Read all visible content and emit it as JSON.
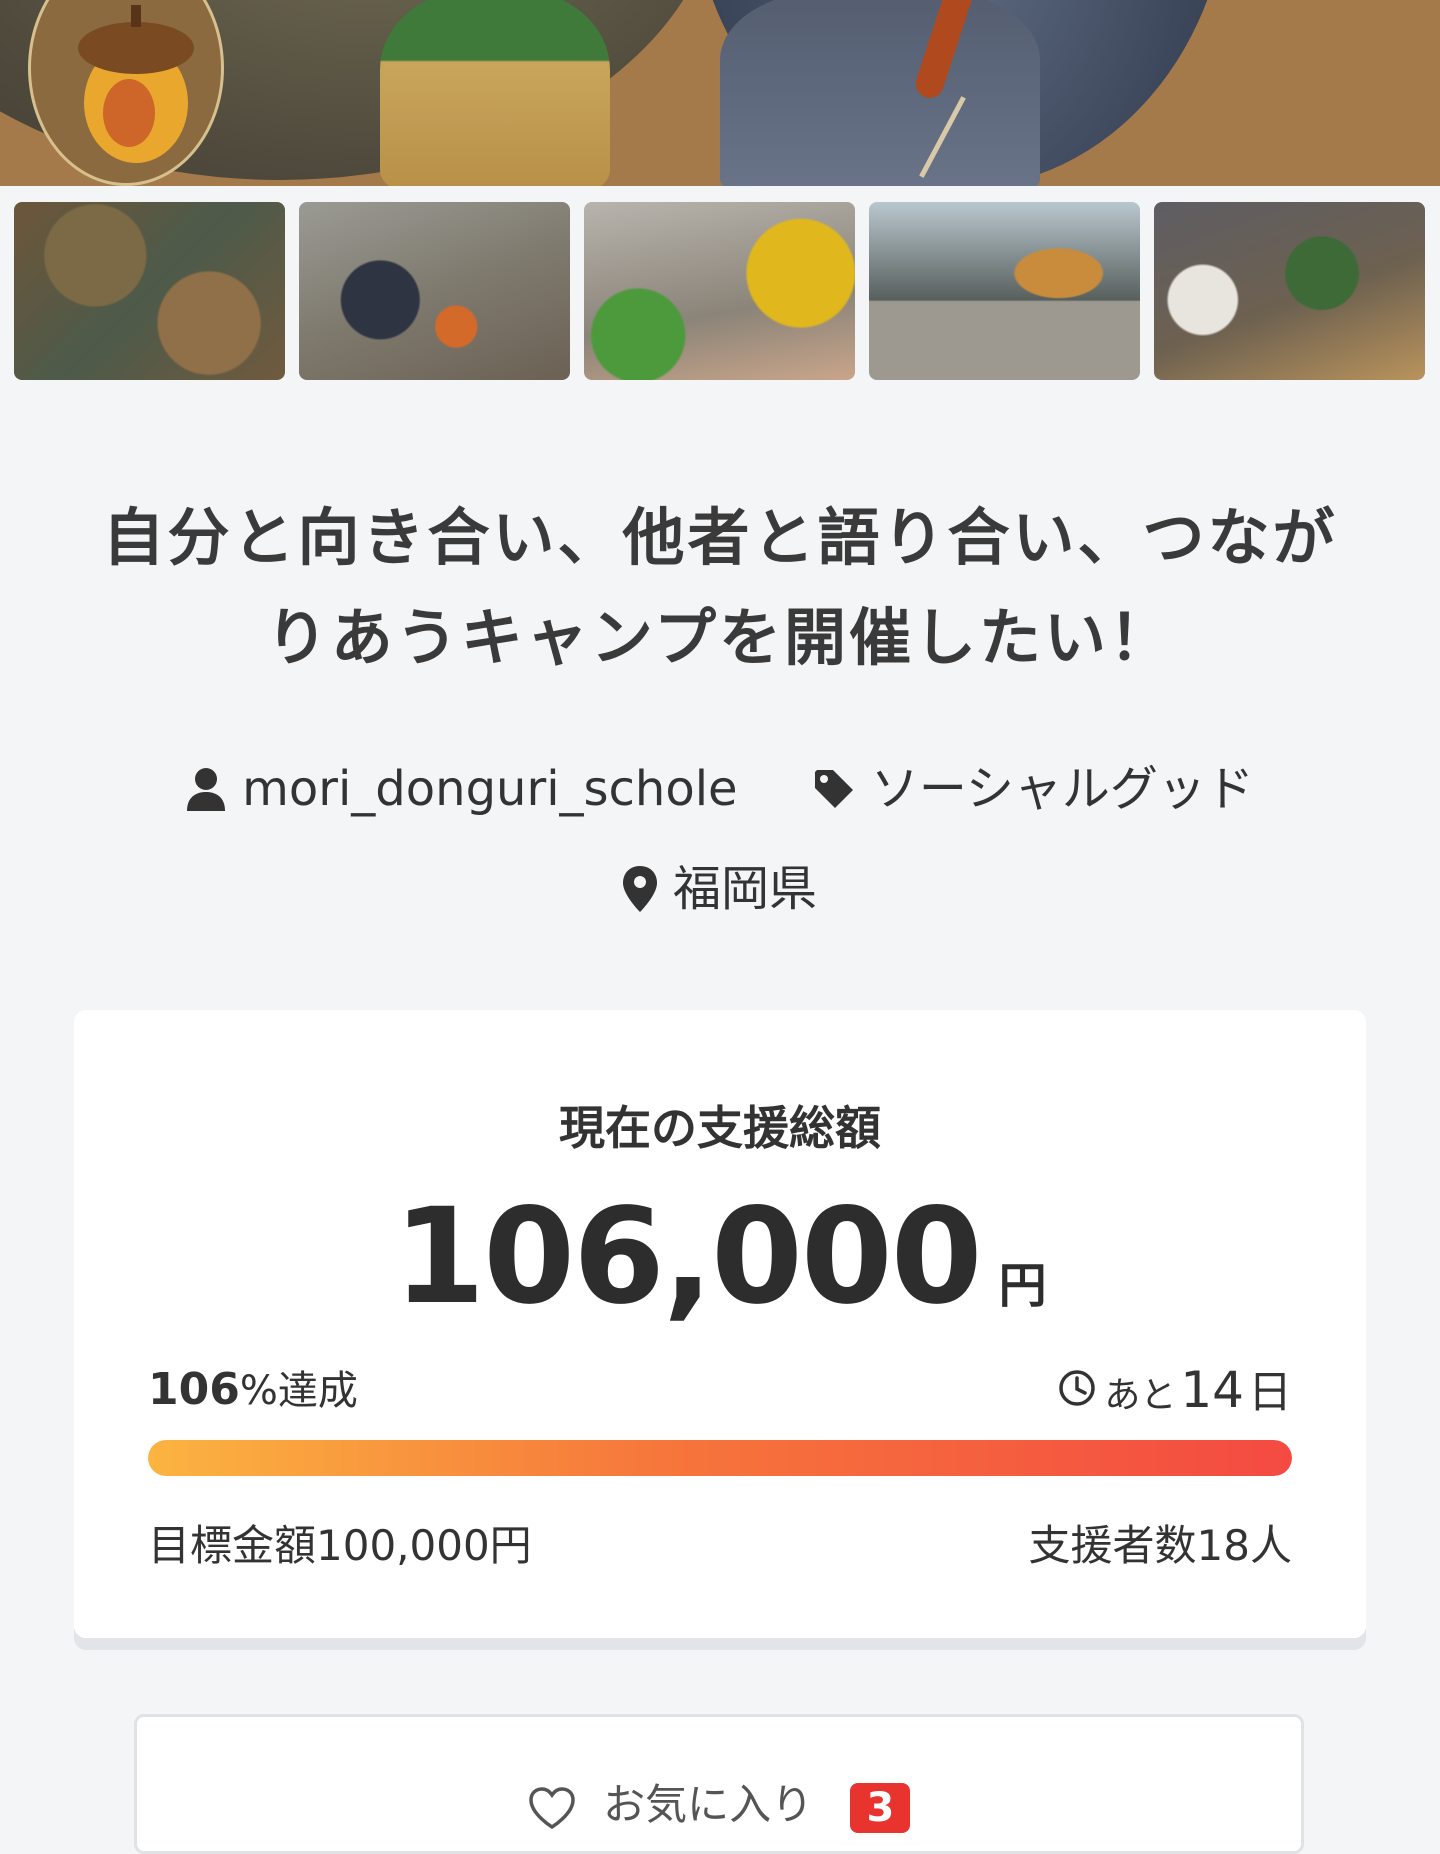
{
  "project": {
    "title": "自分と向き合い、他者と語り合い、つながりあうキャンプを開催したい！",
    "owner": "mori_donguri_schole",
    "category": "ソーシャルグッド",
    "location": "福岡県"
  },
  "icons": {
    "owner": "user-icon",
    "category": "tag-icon",
    "location": "map-pin-icon",
    "remaining": "clock-icon",
    "favorite": "heart-icon"
  },
  "gallery": {
    "thumbnail_count": 5
  },
  "funding": {
    "heading": "現在の支援総額",
    "amount": "106,000",
    "amount_unit": "円",
    "percent": "106",
    "percent_label": "%達成",
    "percent_value": 106,
    "remaining_prefix": "あと",
    "remaining_days": "14",
    "remaining_unit": "日",
    "goal_text": "目標金額100,000円",
    "backers_text": "支援者数18人"
  },
  "favorite": {
    "label": "お気に入り",
    "count": "3"
  },
  "colors": {
    "page_bg": "#f4f5f7",
    "progress_start": "#fbb440",
    "progress_end": "#f44a42",
    "badge": "#e8332e"
  }
}
